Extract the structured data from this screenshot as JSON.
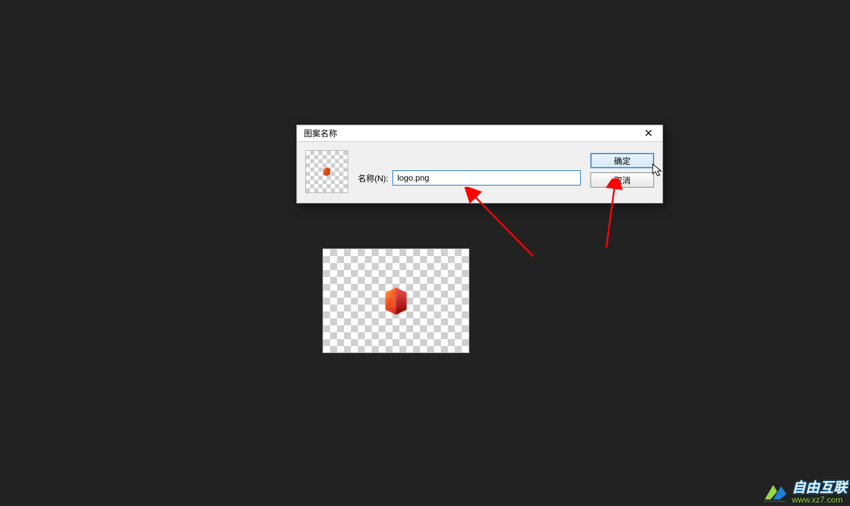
{
  "dialog": {
    "title": "图案名称",
    "name_label": "名称(N):",
    "name_value": "logo.png",
    "ok_label": "确定",
    "cancel_label": "取消",
    "close_icon": "close-icon"
  },
  "preview": {
    "icon": "office-logo-icon"
  },
  "canvas": {
    "icon": "office-logo-icon"
  },
  "watermark": {
    "line1": "自由互联",
    "line2": "www.xz7.com"
  }
}
